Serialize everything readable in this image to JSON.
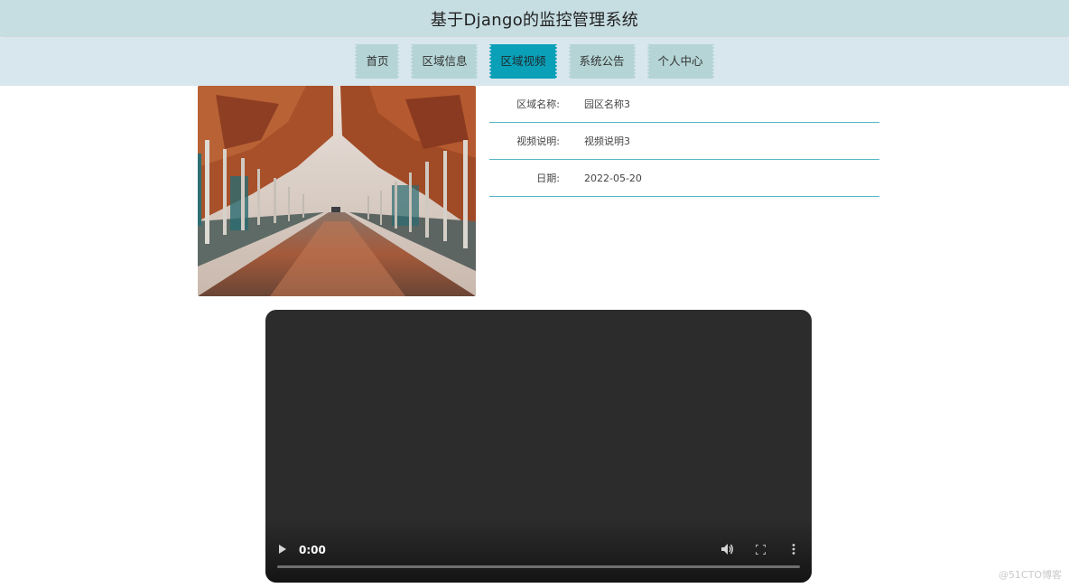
{
  "header": {
    "title": "基于Django的监控管理系统"
  },
  "nav": {
    "items": [
      {
        "label": "首页"
      },
      {
        "label": "区域信息"
      },
      {
        "label": "区域视频",
        "active": true
      },
      {
        "label": "系统公告"
      },
      {
        "label": "个人中心"
      }
    ]
  },
  "detail": {
    "fields": [
      {
        "label": "区域名称:",
        "value": "园区名称3"
      },
      {
        "label": "视频说明:",
        "value": "视频说明3"
      },
      {
        "label": "日期:",
        "value": "2022-05-20"
      }
    ]
  },
  "video": {
    "time": "0:00",
    "icons": [
      "play-icon",
      "volume-icon",
      "fullscreen-icon",
      "more-options-icon"
    ]
  },
  "watermark": "@51CTO博客",
  "colors": {
    "header_bg": "#c6dde2",
    "nav_bg": "#d8e6ee",
    "nav_item_bg": "#b4d4d5",
    "nav_active_bg": "#0aa0b8",
    "divider": "#55b7c6",
    "video_bg": "#2c2c2c"
  }
}
